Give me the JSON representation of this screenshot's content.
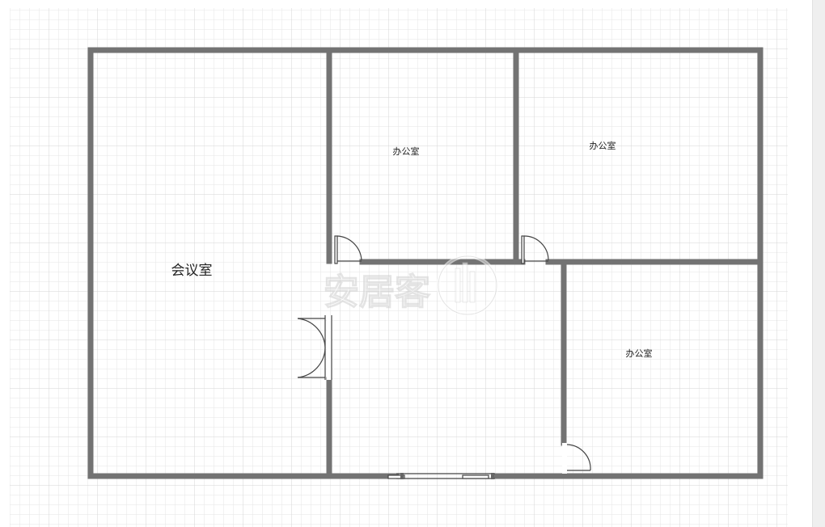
{
  "floorplan": {
    "rooms": [
      {
        "id": "meeting-room",
        "label": "会议室"
      },
      {
        "id": "office-top-middle",
        "label": "办公室"
      },
      {
        "id": "office-top-right",
        "label": "办公室"
      },
      {
        "id": "office-bottom-right",
        "label": "办公室"
      }
    ],
    "watermark": "安居客",
    "colors": {
      "wall": "#737373",
      "grid_minor": "#e6e6e6",
      "grid_major": "#d6d6d6",
      "door": "#444444"
    }
  }
}
